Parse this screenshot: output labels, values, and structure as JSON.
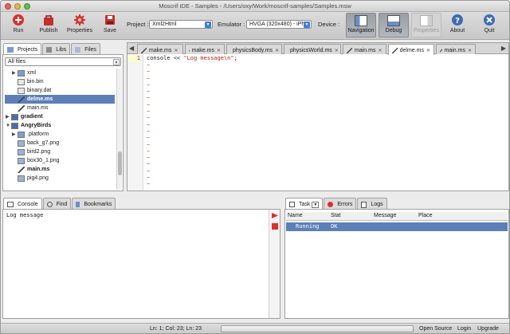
{
  "window": {
    "title": "Moscrif IDE - Samples - /Users/oxy/Work/moscrif-samples/Samples.msw",
    "lights": [
      "#ec5f57",
      "#e0b744",
      "#5fc043"
    ]
  },
  "toolbar": {
    "run_label": "Run",
    "publish_label": "Publish",
    "properties_label": "Properties",
    "save_label": "Save",
    "project_label": "Project :",
    "project_value": "Xml2Html",
    "emulator_label": "Emulator :",
    "emulator_value": "HVGA (320x480) - iPh",
    "device_label": "Device :",
    "navigation_label": "Navigation",
    "debug_label": "Debug",
    "properties_toggle_label": "Properties",
    "about_label": "About",
    "quit_label": "Quit"
  },
  "left": {
    "tabs": [
      {
        "label": "Projects"
      },
      {
        "label": "Libs"
      },
      {
        "label": "Files"
      }
    ],
    "filter_value": "All files",
    "tree": [
      {
        "label": "xml",
        "type": "folder",
        "indent": 1,
        "disclose": "▶"
      },
      {
        "label": "bin.bin",
        "type": "file",
        "indent": 1
      },
      {
        "label": "binary.dat",
        "type": "file",
        "indent": 1
      },
      {
        "label": "delme.ms",
        "type": "ms",
        "indent": 1,
        "selected": true
      },
      {
        "label": "main.ms",
        "type": "ms",
        "indent": 1
      },
      {
        "label": "gradient",
        "type": "project",
        "indent": 0,
        "disclose": "▶",
        "bold": true
      },
      {
        "label": "AngryBirds",
        "type": "project",
        "indent": 0,
        "disclose": "▼",
        "bold": true
      },
      {
        "label": ".platform",
        "type": "folder",
        "indent": 1,
        "disclose": "▶"
      },
      {
        "label": "back_g7.png",
        "type": "image",
        "indent": 1
      },
      {
        "label": "bird2.png",
        "type": "image",
        "indent": 1
      },
      {
        "label": "box30_1.png",
        "type": "image",
        "indent": 1
      },
      {
        "label": "main.ms",
        "type": "ms",
        "indent": 1,
        "bold": true
      },
      {
        "label": "pig4.png",
        "type": "image",
        "indent": 1
      }
    ]
  },
  "editor": {
    "tabs": [
      {
        "label": "make.ms"
      },
      {
        "label": "make.ms"
      },
      {
        "label": "physicsBody.ms"
      },
      {
        "label": "physicsWorld.ms"
      },
      {
        "label": "main.ms"
      },
      {
        "label": "delme.ms",
        "active": true
      },
      {
        "label": "main.ms"
      }
    ],
    "line_number": "1",
    "code_prefix": "console << ",
    "code_string": "\"Log message\\n\"",
    "code_suffix": ";",
    "tilde": "~"
  },
  "bottom_left": {
    "tabs": [
      {
        "label": "Console"
      },
      {
        "label": "Find"
      },
      {
        "label": "Bookmarks"
      }
    ],
    "console_text": "Log message"
  },
  "bottom_right": {
    "tabs": [
      {
        "label": "Task"
      },
      {
        "label": "Errors"
      },
      {
        "label": "Logs"
      }
    ],
    "columns": [
      "Name",
      "Stat",
      "Message",
      "Place"
    ],
    "row": {
      "name": "Running",
      "stat": "OK",
      "message": "",
      "place": ""
    }
  },
  "status": {
    "position": "Ln: 1; Col: 23; Ln: 23",
    "open_source": "Open Source",
    "login": "Login",
    "upgrade": "Upgrade"
  }
}
